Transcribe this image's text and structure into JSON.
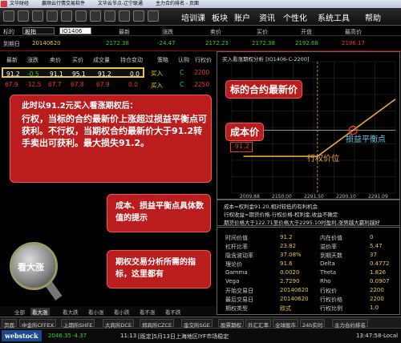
{
  "titlebar": {
    "items": [
      "文华财经",
      "赢顺云行情交易软件",
      "文华云节点-辽宁联通",
      "主力合约排名 - 页面"
    ]
  },
  "menubar": {
    "items": [
      "培训课",
      "板块",
      "账户",
      "资讯",
      "个性化",
      "系统工具",
      "帮助"
    ]
  },
  "symbol_row": {
    "label": "标的",
    "type_value": "股指",
    "code_value": "IO1406",
    "cols": [
      "最新",
      "涨跌",
      "卖价",
      "买价",
      "开盘",
      "最高价"
    ]
  },
  "code_row": {
    "label": "到期日",
    "date": "20140620",
    "values": [
      "2172.38",
      "-24.47",
      "2172.23",
      "2172.38",
      "2192.68",
      "2196.17"
    ]
  },
  "option_table": {
    "headers": [
      "最新",
      "涨跌",
      "卖价",
      "买价",
      "成交量",
      "持仓变动",
      "溢价",
      "行权价"
    ],
    "rows": [
      {
        "last": "91.2",
        "chg": "-0.5",
        "ask": "91.1",
        "bid": "95.1",
        "vol": "91.2",
        "oi": "0.0",
        "action": "买入",
        "side": "C",
        "strike": "2200"
      },
      {
        "last": "67.9",
        "chg": "-12.5",
        "ask": "67.7",
        "bid": "67.8",
        "vol": "67.9",
        "oi": "0.0",
        "action": "买入",
        "side": "C",
        "strike": "2250"
      }
    ],
    "side_labels": [
      "策略",
      "认购",
      "行权价"
    ]
  },
  "callout_main": {
    "heading": "此时以91.2元买入看涨期权后：",
    "body": "行权，当标的合约最新价上涨超过损益平衡点可获利。不行权，当期权合约最新价大于91.2转手卖出可获利。最大损失91.2。"
  },
  "chart": {
    "title": "买入看涨期权分析 [IO1406-C-2200]",
    "x_ticks": [
      "2009.88",
      "2150.00",
      "2291.50",
      "2200.10",
      "2291.09"
    ],
    "y_marker": "-91.2",
    "labels": {
      "latest": "标的合约最新价",
      "cost": "成本价",
      "strike": "行权价位",
      "breakeven": "损益平衡点"
    }
  },
  "chart_data": {
    "type": "line",
    "title": "买入看涨期权分析 [IO1406-C-2200]",
    "x": [
      2009.88,
      2200.0,
      2291.2,
      2400.0
    ],
    "series": [
      {
        "values": [
          -91.2,
          -91.2,
          0,
          108.8
        ]
      }
    ],
    "strike": 2200,
    "premium": 91.2
  },
  "info": {
    "lines": [
      "成本=权利金91.20,相对较低的有利机会",
      "行权收益=期货价格-行权价格-权利金,收益不确定",
      "期货价格大于122.71至价格大于2295.10时盈利,涨势越大赢利越好"
    ]
  },
  "callout_price": {
    "text": "成本、损益平衡点具体数值的提示"
  },
  "callout_metrics": {
    "text": "期权交易分析所需的指标，这里都有"
  },
  "lens": {
    "label": "看大涨"
  },
  "metrics": {
    "rows": [
      {
        "k1": "时间价值",
        "v1": "91.2",
        "k2": "内在价值",
        "v2": "0"
      },
      {
        "k1": "杠杆比率",
        "v1": "23.82",
        "k2": "溢价率",
        "v2": "5.47"
      },
      {
        "k1": "隐含波动率",
        "v1": "37.08%",
        "k2": "到期天数",
        "v2": "37"
      },
      {
        "k1": "理论价",
        "v1": "91.6",
        "k2": "Delta",
        "v2": "0.4772"
      },
      {
        "k1": "Gamma",
        "v1": "0.0020",
        "k2": "Theta",
        "v2": "1.826"
      },
      {
        "k1": "Vega",
        "v1": "2.7290",
        "k2": "Rho",
        "v2": "0.0907"
      },
      {
        "k1": "开始交易日",
        "v1": "20140620",
        "k2": "行权价",
        "v2": "2200"
      },
      {
        "k1": "最后交易日",
        "v1": "20140620",
        "k2": "行权价格",
        "v2": "2200"
      },
      {
        "k1": "期权类型",
        "v1": "欧式",
        "k2": "行权比例",
        "v2": "1:0"
      }
    ]
  },
  "bottom_tabs": [
    "全部",
    "看大涨",
    "看大跌",
    "看小涨",
    "看小跌",
    "看不涨",
    "看不跌"
  ],
  "sheet_tabs": [
    "页面",
    "中金所CFFEX",
    "上期所SHFE",
    "大商所DCE",
    "郑商所CZCE",
    "金交所SGE",
    "股票期权",
    "外汇汇率",
    "全球股市",
    "24h实时",
    "主力合约排名"
  ],
  "statusbar": {
    "brand": "webstock",
    "index_val": "2046.35",
    "index_chg": "-4.37",
    "time_left": "11:13",
    "notice": "[既定]5月13日上海地区IYF市场稳定",
    "clock": "13:47:58-Local"
  }
}
